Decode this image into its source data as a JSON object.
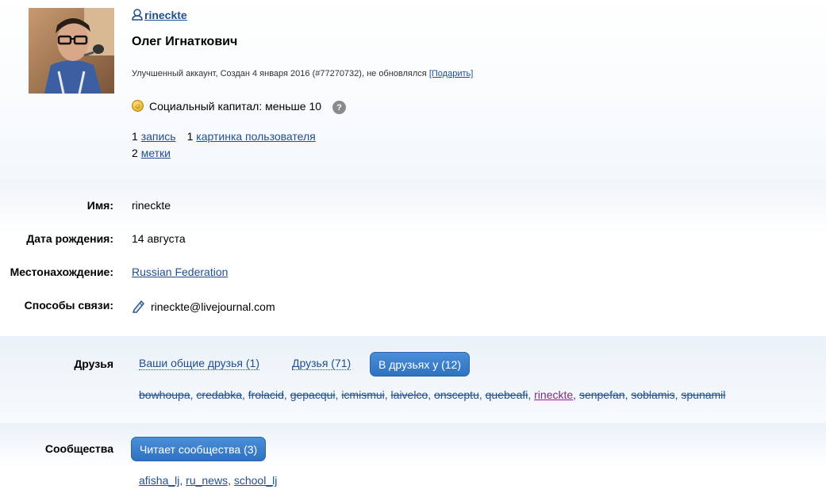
{
  "profile": {
    "username": "rineckte",
    "fullname": "Олег Игнаткович",
    "meta_text": "Улучшенный аккаунт, Создан 4 января 2016 (#77270732),  не обновлялся ",
    "gift_link": "[Подарить]",
    "social_capital": "Социальный капитал: меньше 10",
    "help_glyph": "?",
    "stats": {
      "entries_count": "1",
      "entries_label": "запись",
      "userpics_count": "1",
      "userpics_label": "картинка пользователя",
      "tags_count": "2",
      "tags_label": "метки"
    }
  },
  "info": {
    "name_label": "Имя:",
    "name_value": "rineckte",
    "birthday_label": "Дата рождения:",
    "birthday_value": "14 августа",
    "location_label": "Местонахождение:",
    "location_value": "Russian Federation",
    "contact_label": "Способы связи:",
    "contact_value": "rineckte@livejournal.com"
  },
  "friends": {
    "label": "Друзья",
    "tab_mutual": "Ваши общие друзья (1)",
    "tab_friends": "Друзья (71)",
    "tab_friend_of": "В друзьях у (12)",
    "list": [
      "bowhoupa",
      "credabka",
      "frolacid",
      "gepacqui",
      "icmismui",
      "laivelco",
      "onsceptu",
      "quebeafi",
      "rineckte",
      "senpefan",
      "soblamis",
      "spunamil"
    ],
    "separator": ", "
  },
  "communities": {
    "label": "Сообщества",
    "tab_reads": "Читает сообщества (3)",
    "list": [
      "afisha_lj",
      "ru_news",
      "school_lj"
    ],
    "separator": ", "
  },
  "colors": {
    "link": "#1f4f8f",
    "visited_link": "#8a1f8f",
    "active_tab": "#3a7fcc"
  },
  "icons": {
    "userhead": "user-head-icon",
    "coin": "coin-icon",
    "help": "help-icon",
    "pencil": "pencil-icon"
  }
}
